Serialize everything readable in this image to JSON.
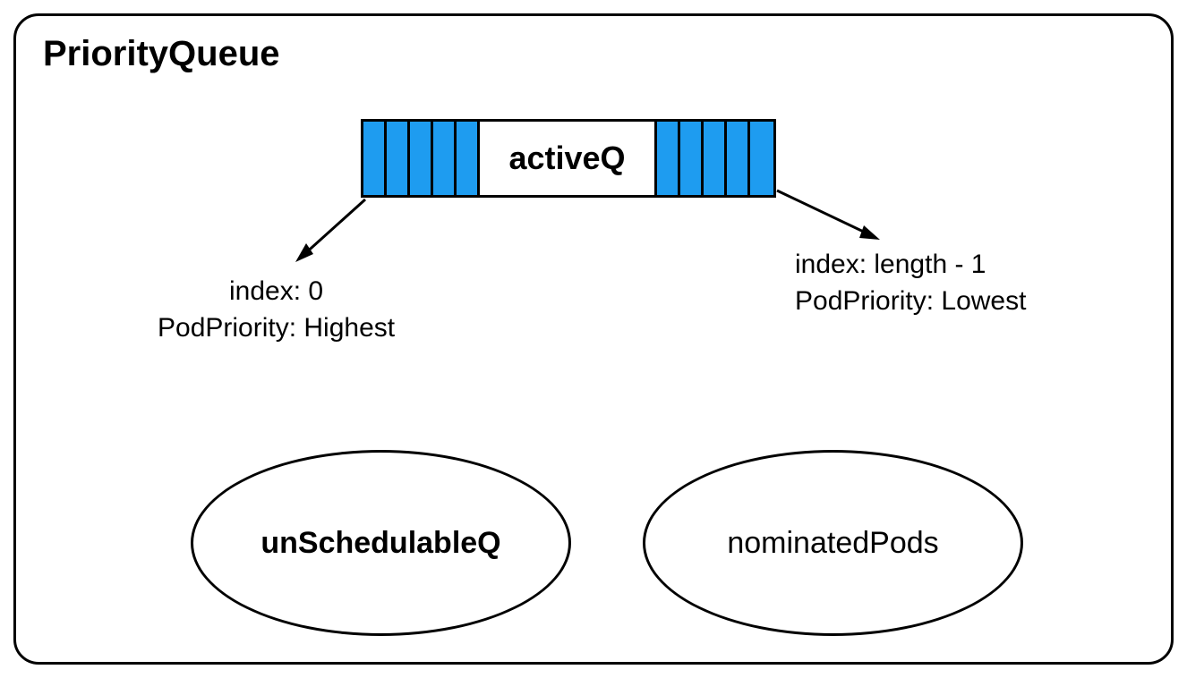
{
  "title": "PriorityQueue",
  "activeQueue": {
    "label": "activeQ",
    "leftCells": 5,
    "rightCells": 5
  },
  "leftAnnotation": {
    "line1": "index: 0",
    "line2": "PodPriority: Highest"
  },
  "rightAnnotation": {
    "line1": "index: length - 1",
    "line2": "PodPriority: Lowest"
  },
  "unschedulableLabel": "unSchedulableQ",
  "nominatedLabel": "nominatedPods",
  "colors": {
    "queueCell": "#1e9cf0",
    "border": "#000000"
  }
}
